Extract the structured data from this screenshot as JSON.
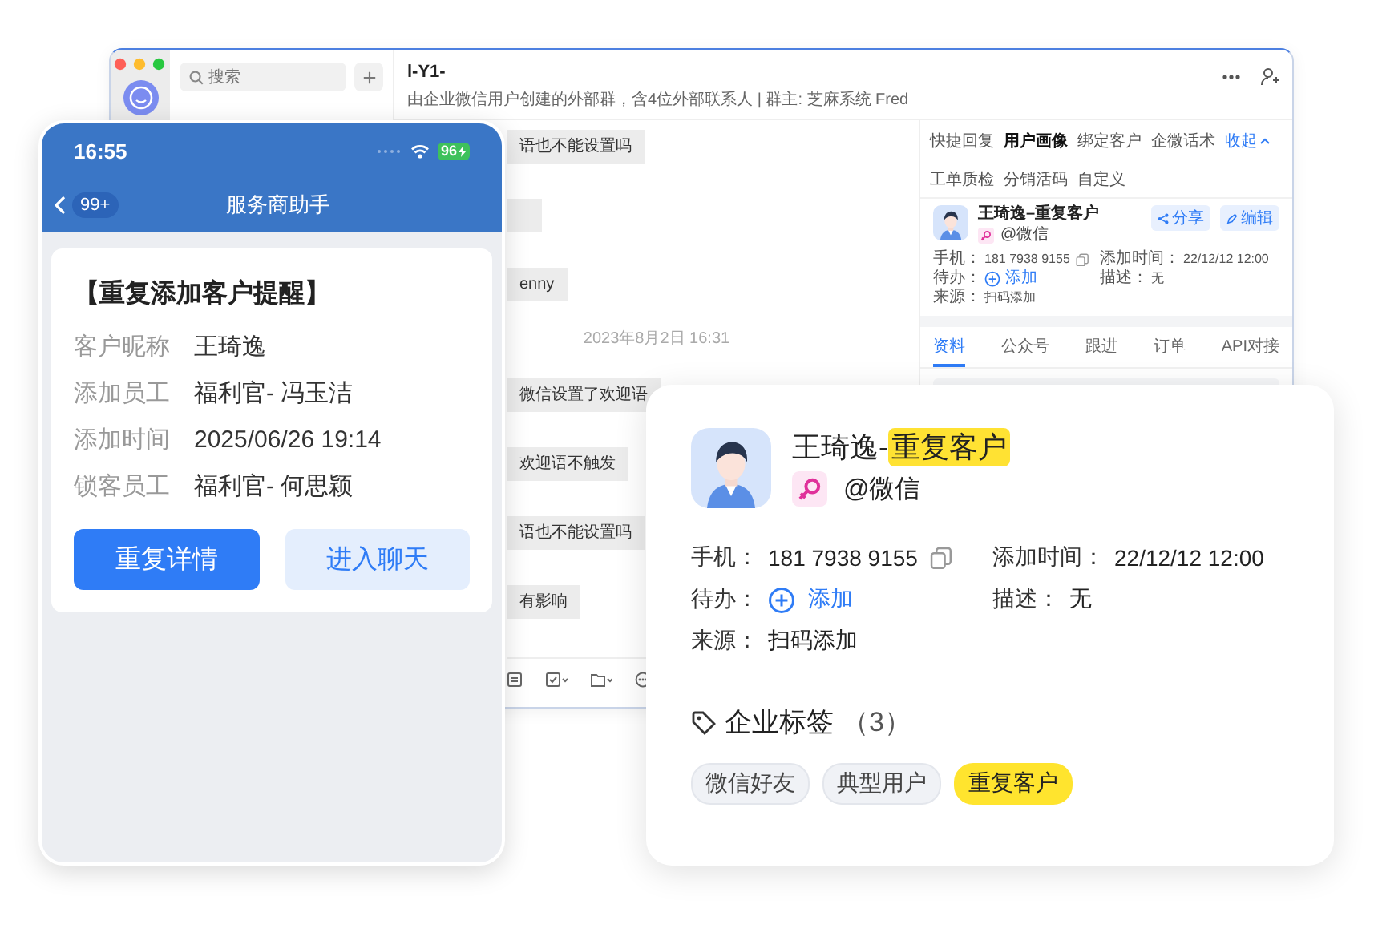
{
  "desktop": {
    "search": {
      "placeholder": "搜索"
    },
    "chat": {
      "title": "l-Y1-",
      "subtitle": "由企业微信用户创建的外部群，含4位外部联系人 | 群主: 芝麻系统 Fred",
      "messages": [
        {
          "kind": "text",
          "text": "语也不能设置吗"
        },
        {
          "kind": "blank"
        },
        {
          "kind": "text",
          "text": "enny"
        },
        {
          "kind": "time",
          "text": "2023年8月2日 16:31"
        },
        {
          "kind": "text",
          "text": "微信设置了欢迎语"
        },
        {
          "kind": "text",
          "text": "欢迎语不触发"
        },
        {
          "kind": "text",
          "text": "语也不能设置吗"
        },
        {
          "kind": "text",
          "text": "有影响"
        }
      ]
    },
    "panel": {
      "tool_tabs": [
        [
          {
            "label": "快捷回复",
            "selected": false
          },
          {
            "label": "用户画像",
            "selected": true
          },
          {
            "label": "绑定客户",
            "selected": false
          },
          {
            "label": "企微话术",
            "selected": false
          }
        ],
        [
          {
            "label": "工单质检",
            "selected": false
          },
          {
            "label": "分销活码",
            "selected": false
          },
          {
            "label": "自定义",
            "selected": false
          }
        ]
      ],
      "collapse": "收起",
      "profile": {
        "name": "王琦逸–重复客户",
        "source": "@微信",
        "share": "分享",
        "edit": "编辑",
        "fields": [
          {
            "kind": "copy",
            "label": "手机：",
            "value": "181 7938 9155"
          },
          {
            "kind": "plain",
            "label": "添加时间：",
            "value": "22/12/12 12:00"
          },
          {
            "kind": "action",
            "label": "待办：",
            "value": "添加"
          },
          {
            "kind": "plain",
            "label": "描述：",
            "value": "无"
          },
          {
            "kind": "plain",
            "label": "来源：",
            "value": "扫码添加"
          }
        ]
      },
      "section_tabs": [
        {
          "label": "资料",
          "selected": true
        },
        {
          "label": "公众号",
          "selected": false
        },
        {
          "label": "跟进",
          "selected": false
        },
        {
          "label": "订单",
          "selected": false
        },
        {
          "label": "API对接",
          "selected": false
        }
      ]
    }
  },
  "phone": {
    "time": "16:55",
    "battery": "96",
    "badge": "99+",
    "title": "服务商助手",
    "card": {
      "title": "【重复添加客户提醒】",
      "rows": [
        {
          "label": "客户昵称",
          "value": "王琦逸"
        },
        {
          "label": "添加员工",
          "value": "福利官- 冯玉洁"
        },
        {
          "label": "添加时间",
          "value": "2025/06/26 19:14"
        },
        {
          "label": "锁客员工",
          "value": "福利官- 何思颖"
        }
      ],
      "buttons": [
        {
          "kind": "primary",
          "label": "重复详情"
        },
        {
          "kind": "secondary",
          "label": "进入聊天"
        }
      ]
    }
  },
  "card": {
    "name": "王琦逸-",
    "name_tag": "重复客户",
    "source": "@微信",
    "fields": [
      {
        "kind": "copy",
        "label": "手机：",
        "value": "181 7938 9155"
      },
      {
        "kind": "plain",
        "label": "添加时间：",
        "value": "22/12/12 12:00"
      },
      {
        "kind": "action",
        "label": "待办：",
        "value": "添加"
      },
      {
        "kind": "plain",
        "label": "描述：",
        "value": "无"
      },
      {
        "kind": "plain",
        "label": "来源：",
        "value": "扫码添加"
      }
    ],
    "tags_title": "企业标签",
    "tags_count": "（3）",
    "tags": [
      {
        "label": "微信好友",
        "highlighted": false
      },
      {
        "label": "典型用户",
        "highlighted": false
      },
      {
        "label": "重复客户",
        "highlighted": true
      }
    ]
  }
}
